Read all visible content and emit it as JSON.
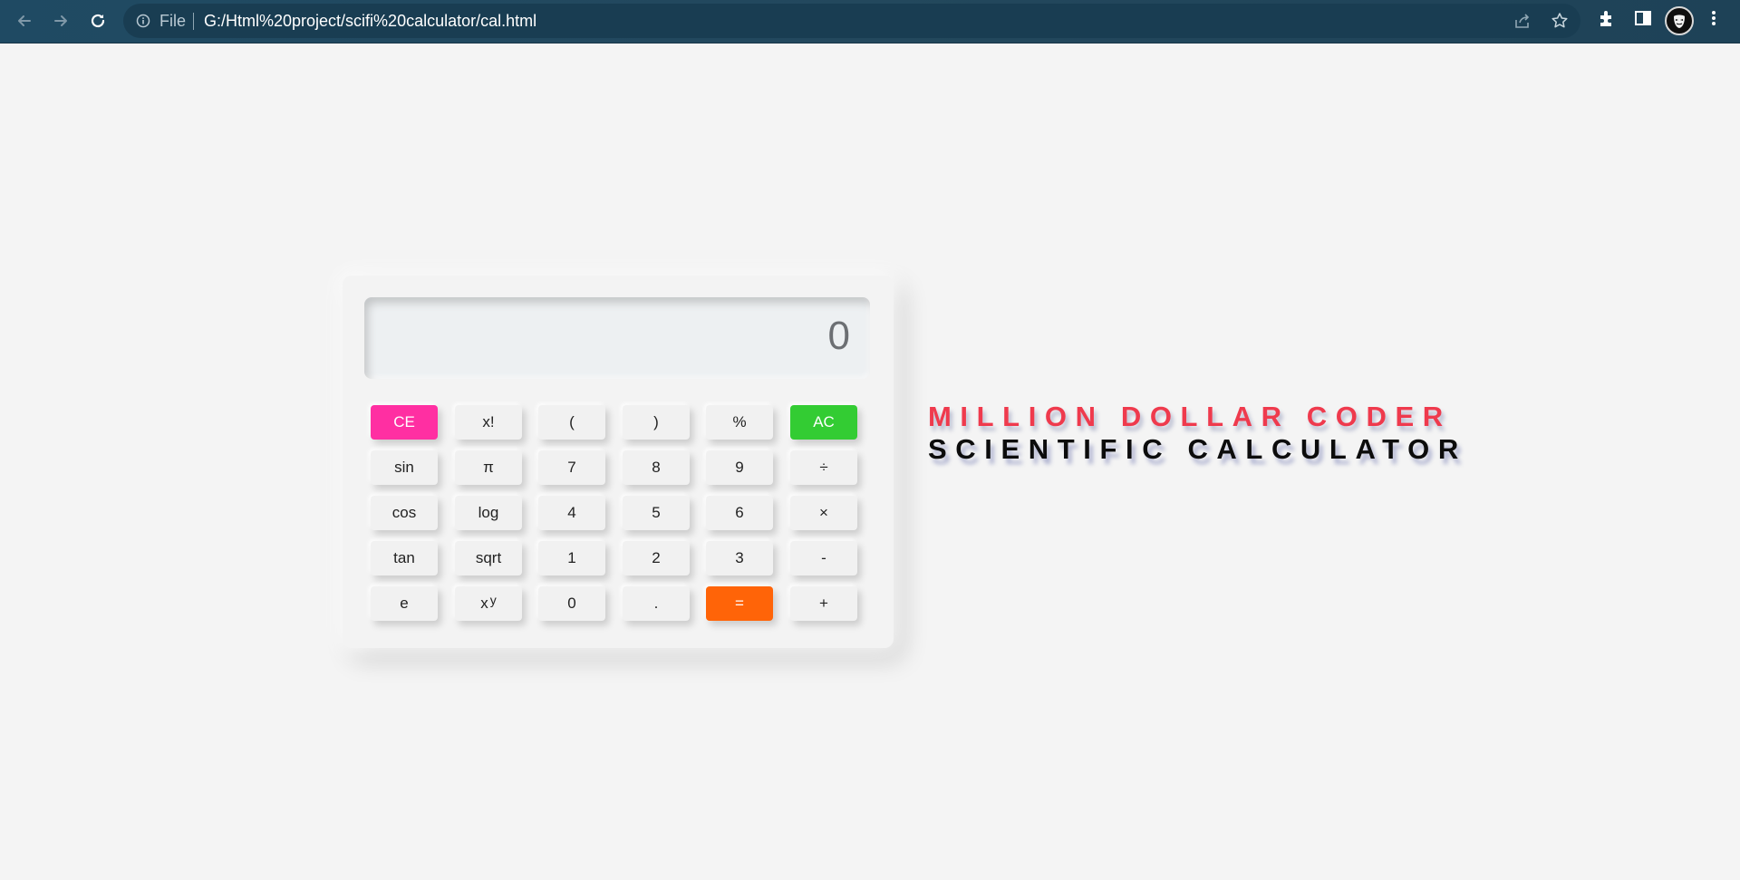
{
  "browser": {
    "file_label": "File",
    "url": "G:/Html%20project/scifi%20calculator/cal.html"
  },
  "calculator": {
    "display_value": "0",
    "rows": [
      [
        {
          "label": "CE",
          "name": "ce-button",
          "style": "ce"
        },
        {
          "label": "x!",
          "name": "factorial-button"
        },
        {
          "label": "(",
          "name": "open-paren-button"
        },
        {
          "label": ")",
          "name": "close-paren-button"
        },
        {
          "label": "%",
          "name": "percent-button"
        },
        {
          "label": "AC",
          "name": "ac-button",
          "style": "ac"
        }
      ],
      [
        {
          "label": "sin",
          "name": "sin-button"
        },
        {
          "label": "π",
          "name": "pi-button"
        },
        {
          "label": "7",
          "name": "digit-7-button"
        },
        {
          "label": "8",
          "name": "digit-8-button"
        },
        {
          "label": "9",
          "name": "digit-9-button"
        },
        {
          "label": "÷",
          "name": "divide-button"
        }
      ],
      [
        {
          "label": "cos",
          "name": "cos-button"
        },
        {
          "label": "log",
          "name": "log-button"
        },
        {
          "label": "4",
          "name": "digit-4-button"
        },
        {
          "label": "5",
          "name": "digit-5-button"
        },
        {
          "label": "6",
          "name": "digit-6-button"
        },
        {
          "label": "×",
          "name": "multiply-button"
        }
      ],
      [
        {
          "label": "tan",
          "name": "tan-button"
        },
        {
          "label": "sqrt",
          "name": "sqrt-button"
        },
        {
          "label": "1",
          "name": "digit-1-button"
        },
        {
          "label": "2",
          "name": "digit-2-button"
        },
        {
          "label": "3",
          "name": "digit-3-button"
        },
        {
          "label": "-",
          "name": "subtract-button"
        }
      ],
      [
        {
          "label": "e",
          "name": "euler-button"
        },
        {
          "label": "x",
          "sup": "y",
          "name": "power-button"
        },
        {
          "label": "0",
          "name": "digit-0-button"
        },
        {
          "label": ".",
          "name": "decimal-button"
        },
        {
          "label": "=",
          "name": "equals-button",
          "style": "eq"
        },
        {
          "label": "+",
          "name": "add-button"
        }
      ]
    ]
  },
  "headline": {
    "line1": "MILLION DOLLAR CODER",
    "line2": "SCIENTIFIC CALCULATOR"
  },
  "colors": {
    "ce": "#ff2fa2",
    "ac": "#33cc33",
    "equals": "#ff6408",
    "headline_red": "#ef3a4d"
  }
}
